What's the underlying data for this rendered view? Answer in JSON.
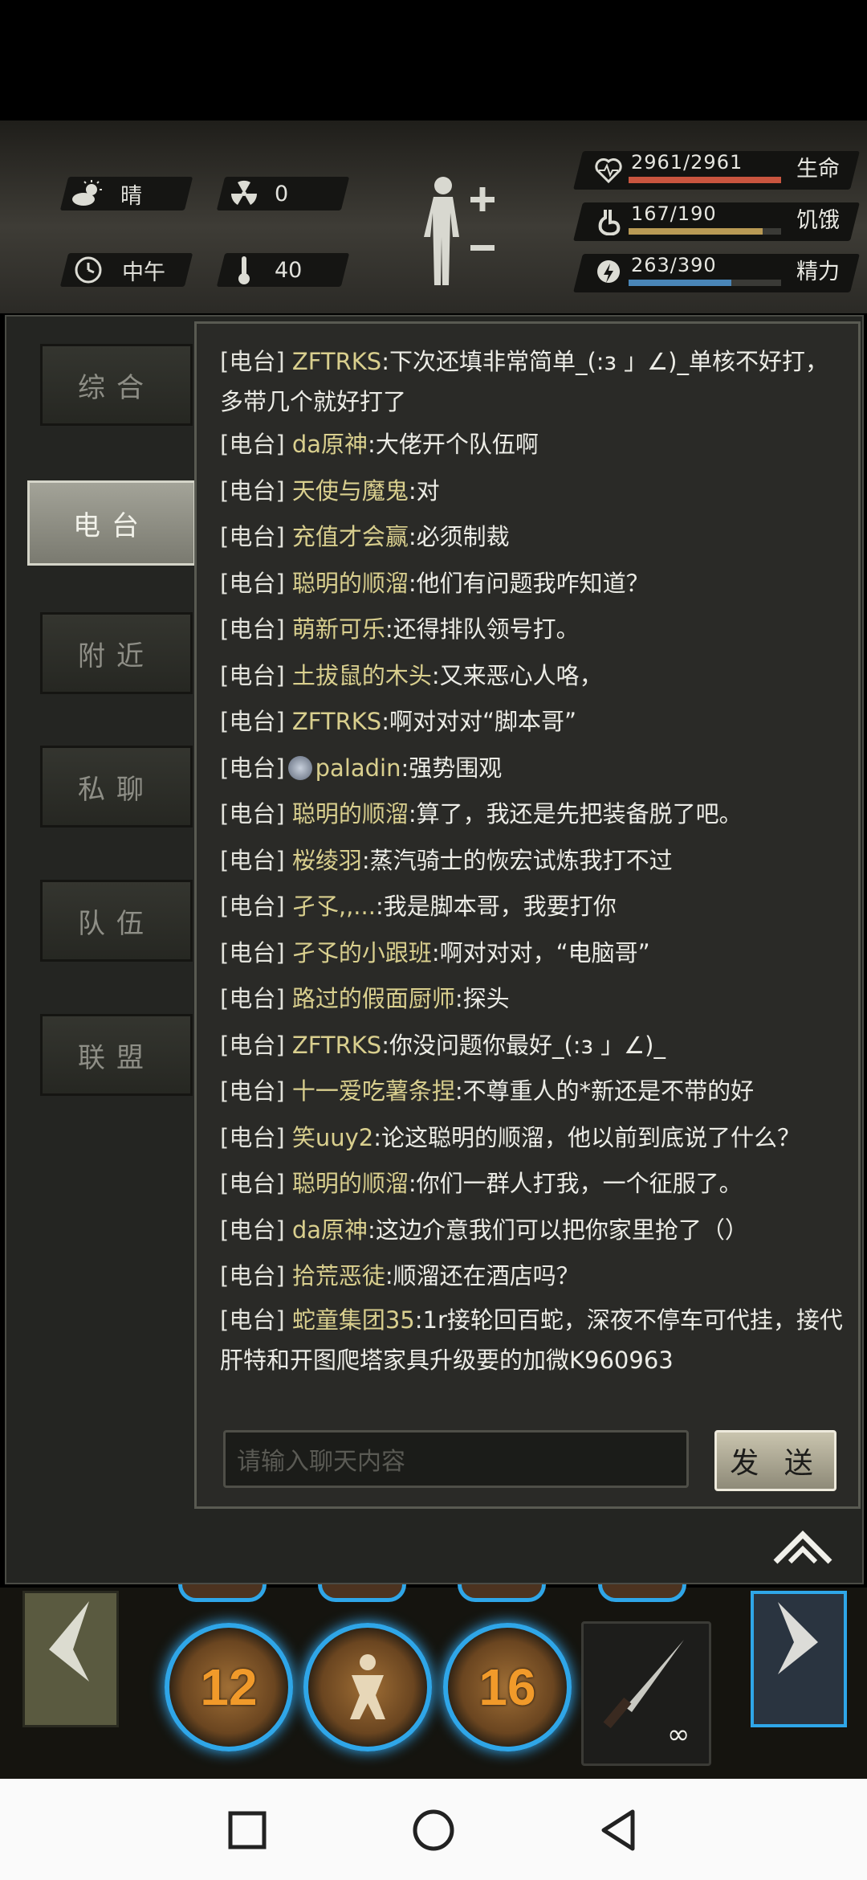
{
  "hud": {
    "weather": "晴",
    "radiation": "0",
    "time_of_day": "中午",
    "temperature": "40",
    "vitals": [
      {
        "value": "2961/2961",
        "label": "生命",
        "fraction": 1.0,
        "color": "#c9553f",
        "icon": "heart-icon"
      },
      {
        "value": "167/190",
        "label": "饥饿",
        "fraction": 0.879,
        "color": "#b99a55",
        "icon": "stomach-icon"
      },
      {
        "value": "263/390",
        "label": "精力",
        "fraction": 0.674,
        "color": "#4a86b8",
        "icon": "energy-icon"
      }
    ]
  },
  "tabs": [
    "综合",
    "电台",
    "附近",
    "私聊",
    "队伍",
    "联盟"
  ],
  "active_tab": "电台",
  "chat": [
    {
      "channel": "[电台]",
      "name": "ZFTRKS",
      "text": ":下次还填非常简单_(:з 」∠)_单核不好打，多带几个就好打了"
    },
    {
      "channel": "[电台]",
      "name": "da原神",
      "text": ":大佬开个队伍啊"
    },
    {
      "channel": "[电台]",
      "name": "天使与魔鬼",
      "text": ":对"
    },
    {
      "channel": "[电台]",
      "name": "充值才会赢",
      "text": ":必须制裁"
    },
    {
      "channel": "[电台]",
      "name": "聪明的顺溜",
      "text": ":他们有问题我咋知道？"
    },
    {
      "channel": "[电台]",
      "name": "萌新可乐",
      "text": ":还得排队领号打。"
    },
    {
      "channel": "[电台]",
      "name": "土拔鼠的木头",
      "text": ":又来恶心人咯，"
    },
    {
      "channel": "[电台]",
      "name": "ZFTRKS",
      "text": ":啊对对对“脚本哥”"
    },
    {
      "channel": "[电台]",
      "name": "paladin",
      "text": ":强势围观"
    },
    {
      "channel": "[电台]",
      "name": "聪明的顺溜",
      "text": ":算了，我还是先把装备脱了吧。"
    },
    {
      "channel": "[电台]",
      "name": "桜绫羽",
      "text": ":蒸汽骑士的恢宏试炼我打不过"
    },
    {
      "channel": "[电台]",
      "name": "孑孓,,...",
      "text": ":我是脚本哥，我要打你"
    },
    {
      "channel": "[电台]",
      "name": "孑孓的小跟班",
      "text": ":啊对对对，“电脑哥”"
    },
    {
      "channel": "[电台]",
      "name": "路过的假面厨师",
      "text": ":探头"
    },
    {
      "channel": "[电台]",
      "name": "ZFTRKS",
      "text": ":你没问题你最好_(:з 」∠)_"
    },
    {
      "channel": "[电台]",
      "name": "十一爱吃薯条捏",
      "text": ":不尊重人的*新还是不带的好"
    },
    {
      "channel": "[电台]",
      "name": "笑uuy2",
      "text": ":论这聪明的顺溜，他以前到底说了什么？"
    },
    {
      "channel": "[电台]",
      "name": "聪明的顺溜",
      "text": ":你们一群人打我，一个征服了。"
    },
    {
      "channel": "[电台]",
      "name": "da原神",
      "text": ":这边介意我们可以把你家里抢了（）"
    },
    {
      "channel": "[电台]",
      "name": "拾荒恶徒",
      "text": ":顺溜还在酒店吗？"
    },
    {
      "channel": "[电台]",
      "name": "蛇童集团35",
      "text": ":1r接轮回百蛇，深夜不停车可代挂，接代肝特和开图爬塔家具升级要的加微K960963"
    }
  ],
  "input": {
    "placeholder": "请输入聊天内容"
  },
  "send_label": "发 送",
  "skills": [
    {
      "count": "12",
      "icon": "skill-run-icon"
    },
    {
      "count": "",
      "icon": "skill-fight-icon"
    },
    {
      "count": "16",
      "icon": "skill-heal-icon"
    }
  ],
  "weapon": {
    "icon": "machete-icon",
    "count": "∞"
  }
}
